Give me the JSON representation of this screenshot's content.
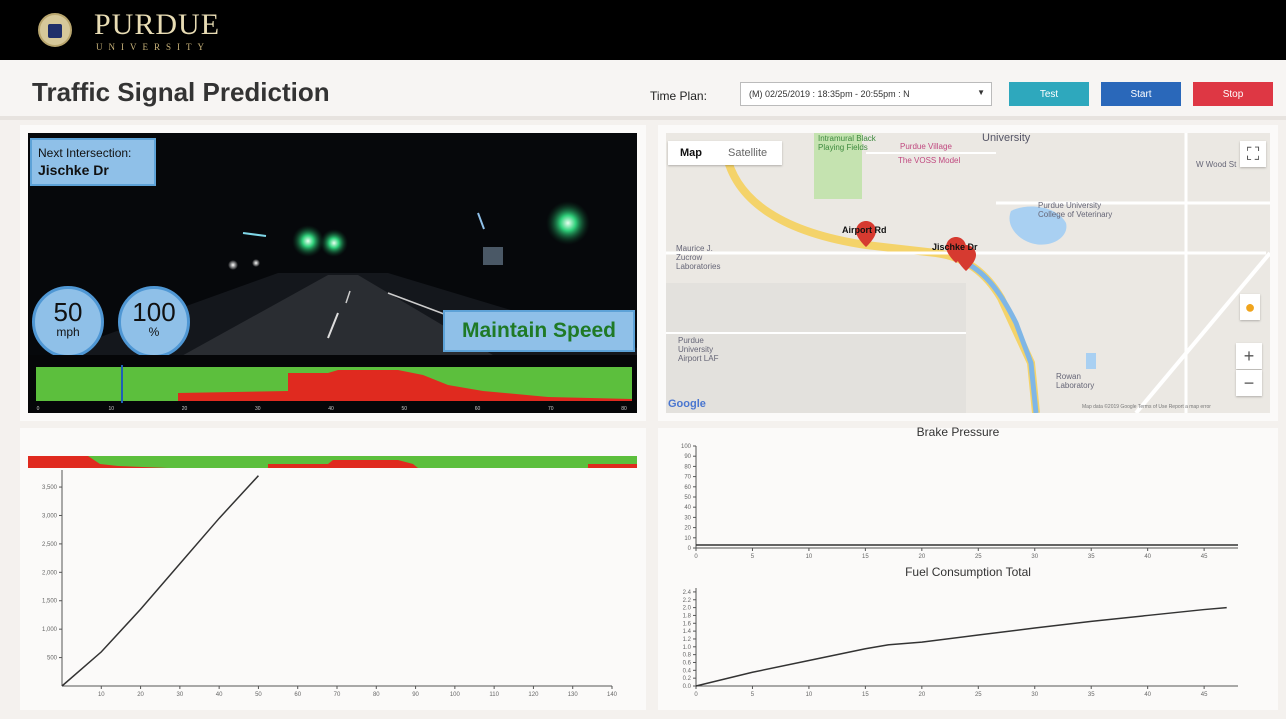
{
  "header": {
    "brand": "PURDUE",
    "brand_sub": "UNIVERSITY",
    "title": "Traffic Signal Prediction",
    "time_plan_label": "Time Plan:",
    "time_plan_value": "(M) 02/25/2019 : 18:35pm - 20:55pm : N",
    "buttons": {
      "test": "Test",
      "start": "Start",
      "stop": "Stop"
    },
    "colors": {
      "test": "#2ea8bd",
      "start": "#2a68ba",
      "stop": "#de3744"
    }
  },
  "video": {
    "next_label": "Next Intersection:",
    "next_value": "Jischke Dr",
    "speed_value": "50",
    "speed_unit": "mph",
    "confidence_value": "100",
    "confidence_unit": "%",
    "advice": "Maintain Speed",
    "timeline_ticks": [
      "0",
      "10",
      "20",
      "30",
      "40",
      "50",
      "60",
      "70",
      "80"
    ]
  },
  "map": {
    "tab_map": "Map",
    "tab_satellite": "Satellite",
    "labels": {
      "university": "University",
      "airport_rd": "Airport Rd",
      "jischke_dr": "Jischke Dr",
      "purdue_airport": "Purdue University Airport LAF",
      "college_vet": "Purdue University College of Veterinary",
      "zucrow": "Maurice J. Zucrow Laboratories",
      "rowan": "Rowan Laboratory",
      "wood_st": "W Wood St",
      "purdue_village": "Purdue Village",
      "slayter": "The VOSS Model",
      "intramural": "Intramural Black Playing Fields"
    },
    "google": "Google",
    "credit": "Map data ©2019 Google   Terms of Use   Report a map error",
    "zoom_in": "+",
    "zoom_out": "−",
    "fullscreen": "⛶"
  },
  "chart_data": [
    {
      "type": "line",
      "title": "",
      "x_ticks": [
        "10",
        "20",
        "30",
        "40",
        "50",
        "60",
        "70",
        "80",
        "90",
        "100",
        "110",
        "120",
        "130",
        "140"
      ],
      "y_ticks": [
        "500",
        "1,000",
        "1,500",
        "2,000",
        "2,500",
        "3,000",
        "3,500"
      ],
      "series": [
        {
          "x": [
            0,
            10,
            20,
            30,
            40,
            50
          ],
          "y": [
            0,
            600,
            1350,
            2150,
            2950,
            3700
          ]
        }
      ],
      "xlim": [
        0,
        140
      ],
      "ylim": [
        0,
        3800
      ],
      "top_band": "green/red signal prediction band"
    },
    {
      "type": "line",
      "title": "Brake Pressure",
      "x_ticks": [
        "0",
        "5",
        "10",
        "15",
        "20",
        "25",
        "30",
        "35",
        "40",
        "45"
      ],
      "y_ticks": [
        "0",
        "10",
        "20",
        "30",
        "40",
        "50",
        "60",
        "70",
        "80",
        "90",
        "100"
      ],
      "series": [
        {
          "x": [
            0,
            5,
            10,
            15,
            20,
            25,
            30,
            35,
            40,
            45,
            48
          ],
          "y": [
            3,
            3,
            3,
            3,
            3,
            3,
            3,
            3,
            3,
            3,
            3
          ]
        }
      ],
      "xlim": [
        0,
        48
      ],
      "ylim": [
        0,
        100
      ]
    },
    {
      "type": "line",
      "title": "Fuel Consumption Total",
      "x_ticks": [
        "0",
        "5",
        "10",
        "15",
        "20",
        "25",
        "30",
        "35",
        "40",
        "45"
      ],
      "y_ticks": [
        "0.0",
        "0.2",
        "0.4",
        "0.6",
        "0.8",
        "1.0",
        "1.2",
        "1.4",
        "1.6",
        "1.8",
        "2.0",
        "2.2",
        "2.4"
      ],
      "series": [
        {
          "x": [
            0,
            5,
            10,
            15,
            17,
            20,
            25,
            30,
            35,
            40,
            45,
            47
          ],
          "y": [
            0.0,
            0.35,
            0.65,
            0.95,
            1.05,
            1.12,
            1.3,
            1.48,
            1.65,
            1.8,
            1.95,
            2.0
          ]
        }
      ],
      "xlim": [
        0,
        48
      ],
      "ylim": [
        0,
        2.5
      ]
    }
  ]
}
